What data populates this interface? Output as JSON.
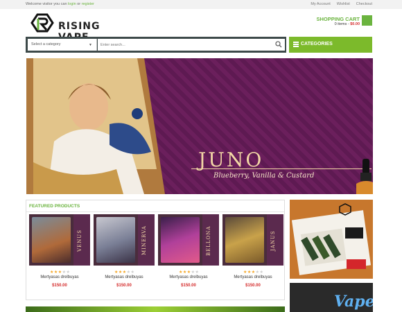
{
  "topbar": {
    "welcome": "Welcome visitor you can ",
    "login": "login",
    "or": " or ",
    "register": "register",
    "links": [
      "My Account",
      "Wishlist",
      "Checkout"
    ]
  },
  "logo": {
    "text": "RISING VAPE"
  },
  "cart": {
    "title": "SHOPPING CART",
    "items": "0 items - ",
    "total": "$0.00"
  },
  "search": {
    "category_label": "Select a category",
    "placeholder": "Enter search..."
  },
  "categories_button": "CATEGORIES",
  "banner": {
    "heading": "JUNO",
    "subheading": "Blueberry, Vanilla & Custard"
  },
  "featured": {
    "title": "FEATURED PRODUCTS",
    "products": [
      {
        "label": "VENUS",
        "name": "Mertyasas drelbuyas",
        "price": "$150.00",
        "rating": 3
      },
      {
        "label": "MINERVA",
        "name": "Mertyasas drelbuyas",
        "price": "$150.00",
        "rating": 3
      },
      {
        "label": "BELLONA",
        "name": "Mertyasas drelbuyas",
        "price": "$150.00",
        "rating": 3
      },
      {
        "label": "JANUS",
        "name": "Mertyasas drelbuyas",
        "price": "$150.00",
        "rating": 3
      }
    ]
  },
  "side_banner_2": {
    "text": "Vape"
  },
  "colors": {
    "accent": "#6bb43f",
    "price": "#d42b2b",
    "banner": "#6b1f5c"
  }
}
